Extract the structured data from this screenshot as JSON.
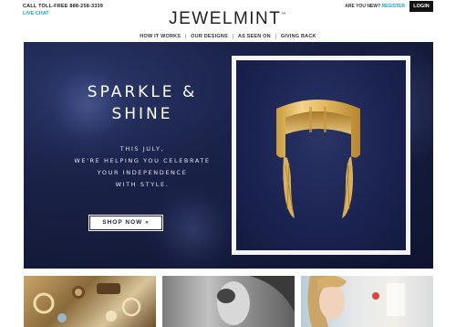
{
  "header": {
    "toll_free": "CALL TOLL-FREE 888-258-3339",
    "live_chat": "LIVE CHAT",
    "logo": "JEWELMINT",
    "logo_tm": "™",
    "are_you_new": "ARE YOU NEW?",
    "register": "REGISTER",
    "login": "LOGIN"
  },
  "nav": {
    "items": [
      "HOW IT WORKS",
      "OUR DESIGNS",
      "AS SEEN ON",
      "GIVING BACK"
    ]
  },
  "hero": {
    "headline_line1": "SPARKLE &",
    "headline_line2": "SHINE",
    "sub_line1": "THIS JULY,",
    "sub_line2": "WE'RE HELPING YOU CELEBRATE",
    "sub_line3": "YOUR INDEPENDENCE",
    "sub_line4": "WITH STYLE.",
    "cta": "SHOP NOW  »"
  },
  "colors": {
    "accent": "#1aa3d6",
    "hero_bg": "#1a2249",
    "login_bg": "#111111",
    "gold": "#d9b25e"
  },
  "thumbnails": [
    "jewelry-collection-image",
    "portrait-black-white-image",
    "model-portrait-image"
  ]
}
